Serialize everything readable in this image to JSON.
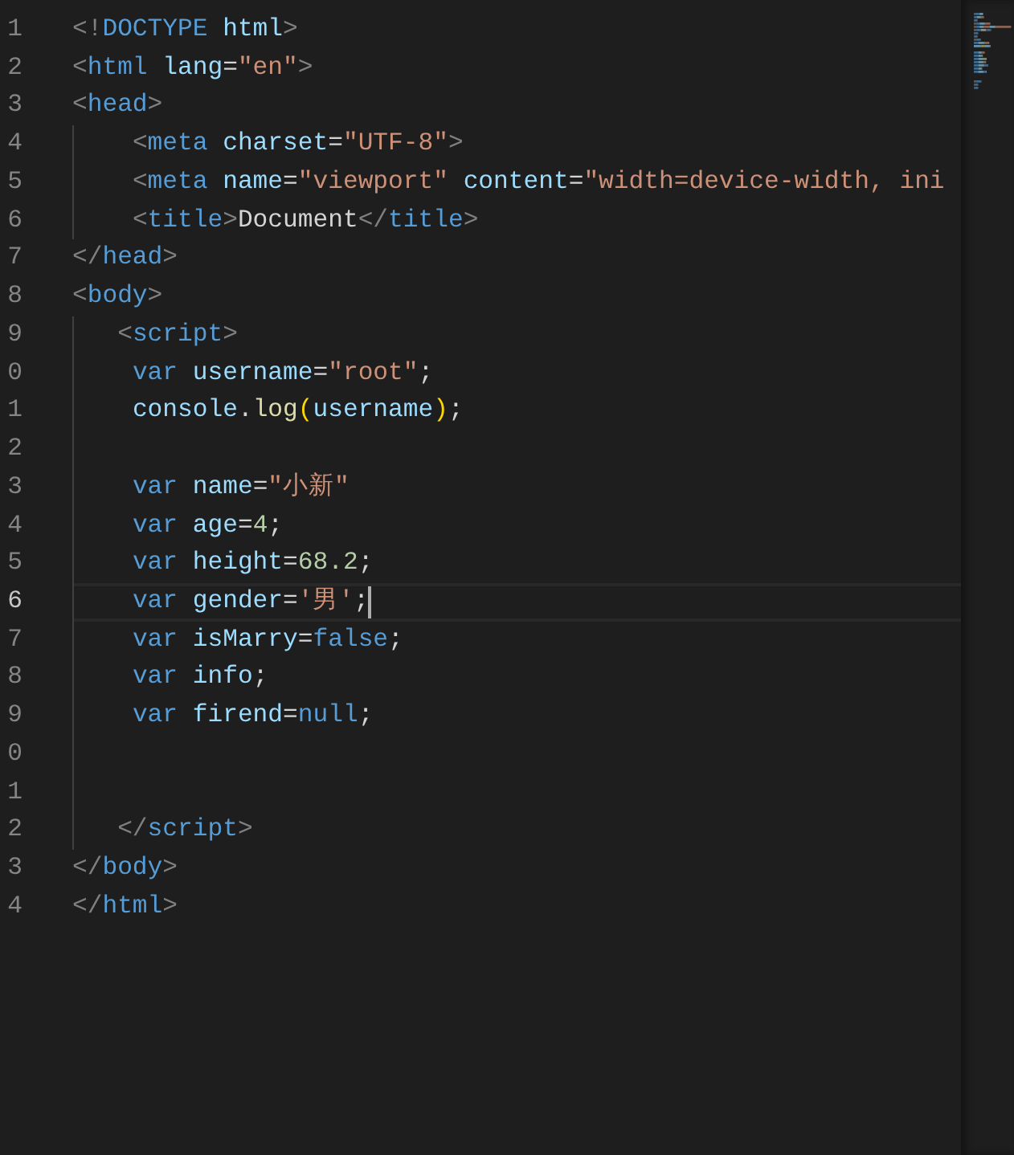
{
  "editor": {
    "lines": [
      {
        "number": "1",
        "current": false,
        "indent_guide": false,
        "tokens": [
          {
            "kind": "punct",
            "text": "<!"
          },
          {
            "kind": "tag",
            "text": "DOCTYPE"
          },
          {
            "kind": "attr",
            "text": " html"
          },
          {
            "kind": "punct",
            "text": ">"
          }
        ]
      },
      {
        "number": "2",
        "current": false,
        "indent_guide": false,
        "tokens": [
          {
            "kind": "punct",
            "text": "<"
          },
          {
            "kind": "tag",
            "text": "html"
          },
          {
            "kind": "attr",
            "text": " lang"
          },
          {
            "kind": "plain",
            "text": "="
          },
          {
            "kind": "string",
            "text": "\"en\""
          },
          {
            "kind": "punct",
            "text": ">"
          }
        ]
      },
      {
        "number": "3",
        "current": false,
        "indent_guide": false,
        "tokens": [
          {
            "kind": "punct",
            "text": "<"
          },
          {
            "kind": "tag",
            "text": "head"
          },
          {
            "kind": "punct",
            "text": ">"
          }
        ]
      },
      {
        "number": "4",
        "current": false,
        "indent_guide": true,
        "tokens": [
          {
            "kind": "punct",
            "text": "    <"
          },
          {
            "kind": "tag",
            "text": "meta"
          },
          {
            "kind": "attr",
            "text": " charset"
          },
          {
            "kind": "plain",
            "text": "="
          },
          {
            "kind": "string",
            "text": "\"UTF-8\""
          },
          {
            "kind": "punct",
            "text": ">"
          }
        ]
      },
      {
        "number": "5",
        "current": false,
        "indent_guide": true,
        "tokens": [
          {
            "kind": "punct",
            "text": "    <"
          },
          {
            "kind": "tag",
            "text": "meta"
          },
          {
            "kind": "attr",
            "text": " name"
          },
          {
            "kind": "plain",
            "text": "="
          },
          {
            "kind": "string",
            "text": "\"viewport\""
          },
          {
            "kind": "attr",
            "text": " content"
          },
          {
            "kind": "plain",
            "text": "="
          },
          {
            "kind": "string",
            "text": "\"width=device-width, ini"
          }
        ]
      },
      {
        "number": "6",
        "current": false,
        "indent_guide": true,
        "tokens": [
          {
            "kind": "punct",
            "text": "    <"
          },
          {
            "kind": "tag",
            "text": "title"
          },
          {
            "kind": "punct",
            "text": ">"
          },
          {
            "kind": "plain",
            "text": "Document"
          },
          {
            "kind": "punct",
            "text": "</"
          },
          {
            "kind": "tag",
            "text": "title"
          },
          {
            "kind": "punct",
            "text": ">"
          }
        ]
      },
      {
        "number": "7",
        "current": false,
        "indent_guide": false,
        "tokens": [
          {
            "kind": "punct",
            "text": "</"
          },
          {
            "kind": "tag",
            "text": "head"
          },
          {
            "kind": "punct",
            "text": ">"
          }
        ]
      },
      {
        "number": "8",
        "current": false,
        "indent_guide": false,
        "tokens": [
          {
            "kind": "punct",
            "text": "<"
          },
          {
            "kind": "tag",
            "text": "body"
          },
          {
            "kind": "punct",
            "text": ">"
          }
        ]
      },
      {
        "number": "9",
        "current": false,
        "indent_guide": true,
        "tokens": [
          {
            "kind": "punct",
            "text": "   <"
          },
          {
            "kind": "tag",
            "text": "script"
          },
          {
            "kind": "punct",
            "text": ">"
          }
        ]
      },
      {
        "number": "0",
        "current": false,
        "indent_guide": true,
        "tokens": [
          {
            "kind": "keyword",
            "text": "    var"
          },
          {
            "kind": "variable",
            "text": " username"
          },
          {
            "kind": "plain",
            "text": "="
          },
          {
            "kind": "string",
            "text": "\"root\""
          },
          {
            "kind": "plain",
            "text": ";"
          }
        ]
      },
      {
        "number": "1",
        "current": false,
        "indent_guide": true,
        "tokens": [
          {
            "kind": "variable",
            "text": "    console"
          },
          {
            "kind": "plain",
            "text": "."
          },
          {
            "kind": "function",
            "text": "log"
          },
          {
            "kind": "bracket",
            "text": "("
          },
          {
            "kind": "variable",
            "text": "username"
          },
          {
            "kind": "bracket",
            "text": ")"
          },
          {
            "kind": "plain",
            "text": ";"
          }
        ]
      },
      {
        "number": "2",
        "current": false,
        "indent_guide": true
      },
      {
        "number": "3",
        "current": false,
        "indent_guide": true,
        "tokens": [
          {
            "kind": "keyword",
            "text": "    var"
          },
          {
            "kind": "variable",
            "text": " name"
          },
          {
            "kind": "plain",
            "text": "="
          },
          {
            "kind": "string",
            "text": "\"小新\""
          }
        ]
      },
      {
        "number": "4",
        "current": false,
        "indent_guide": true,
        "tokens": [
          {
            "kind": "keyword",
            "text": "    var"
          },
          {
            "kind": "variable",
            "text": " age"
          },
          {
            "kind": "plain",
            "text": "="
          },
          {
            "kind": "number",
            "text": "4"
          },
          {
            "kind": "plain",
            "text": ";"
          }
        ]
      },
      {
        "number": "5",
        "current": false,
        "indent_guide": true,
        "tokens": [
          {
            "kind": "keyword",
            "text": "    var"
          },
          {
            "kind": "variable",
            "text": " height"
          },
          {
            "kind": "plain",
            "text": "="
          },
          {
            "kind": "number",
            "text": "68.2"
          },
          {
            "kind": "plain",
            "text": ";"
          }
        ]
      },
      {
        "number": "6",
        "current": true,
        "indent_guide": true,
        "tokens": [
          {
            "kind": "keyword",
            "text": "    var"
          },
          {
            "kind": "variable",
            "text": " gender"
          },
          {
            "kind": "plain",
            "text": "="
          },
          {
            "kind": "string",
            "text": "'男'"
          },
          {
            "kind": "plain",
            "text": ";"
          }
        ]
      },
      {
        "number": "7",
        "current": false,
        "indent_guide": true,
        "tokens": [
          {
            "kind": "keyword",
            "text": "    var"
          },
          {
            "kind": "variable",
            "text": " isMarry"
          },
          {
            "kind": "plain",
            "text": "="
          },
          {
            "kind": "keyword",
            "text": "false"
          },
          {
            "kind": "plain",
            "text": ";"
          }
        ]
      },
      {
        "number": "8",
        "current": false,
        "indent_guide": true,
        "tokens": [
          {
            "kind": "keyword",
            "text": "    var"
          },
          {
            "kind": "variable",
            "text": " info"
          },
          {
            "kind": "plain",
            "text": ";"
          }
        ]
      },
      {
        "number": "9",
        "current": false,
        "indent_guide": true,
        "tokens": [
          {
            "kind": "keyword",
            "text": "    var"
          },
          {
            "kind": "variable",
            "text": " firend"
          },
          {
            "kind": "plain",
            "text": "="
          },
          {
            "kind": "keyword",
            "text": "null"
          },
          {
            "kind": "plain",
            "text": ";"
          }
        ]
      },
      {
        "number": "0",
        "current": false,
        "indent_guide": true
      },
      {
        "number": "1",
        "current": false,
        "indent_guide": true
      },
      {
        "number": "2",
        "current": false,
        "indent_guide": true,
        "tokens": [
          {
            "kind": "punct",
            "text": "   </"
          },
          {
            "kind": "tag",
            "text": "script"
          },
          {
            "kind": "punct",
            "text": ">"
          }
        ]
      },
      {
        "number": "3",
        "current": false,
        "indent_guide": false,
        "tokens": [
          {
            "kind": "punct",
            "text": "</"
          },
          {
            "kind": "tag",
            "text": "body"
          },
          {
            "kind": "punct",
            "text": ">"
          }
        ]
      },
      {
        "number": "4",
        "current": false,
        "indent_guide": false,
        "tokens": [
          {
            "kind": "punct",
            "text": "</"
          },
          {
            "kind": "tag",
            "text": "html"
          },
          {
            "kind": "punct",
            "text": ">"
          }
        ]
      }
    ]
  }
}
